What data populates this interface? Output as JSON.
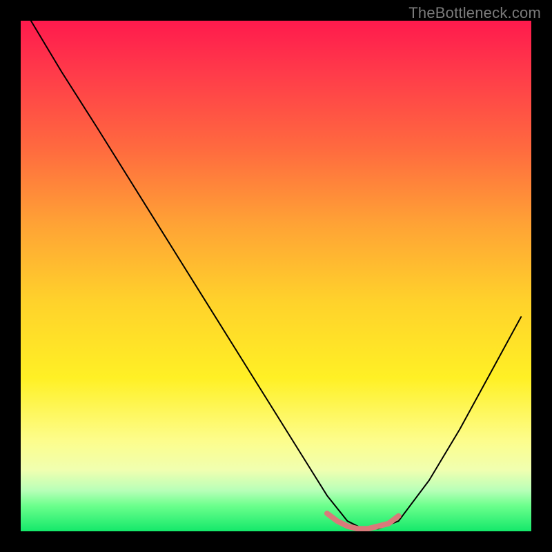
{
  "watermark": "TheBottleneck.com",
  "chart_data": {
    "type": "line",
    "title": "",
    "xlabel": "",
    "ylabel": "",
    "xlim": [
      0,
      100
    ],
    "ylim": [
      0,
      100
    ],
    "background": "rainbow-gradient (red top → green bottom)",
    "series": [
      {
        "name": "curve",
        "color": "#000000",
        "stroke_width": 2,
        "x": [
          2,
          8,
          15,
          25,
          35,
          45,
          55,
          60,
          64,
          67,
          70,
          74,
          80,
          86,
          92,
          98
        ],
        "y": [
          100,
          90,
          79,
          63,
          47,
          31,
          15,
          7,
          2,
          0.5,
          0.5,
          2,
          10,
          20,
          31,
          42
        ]
      },
      {
        "name": "valley-highlight",
        "color": "#d97a7a",
        "stroke_width": 8,
        "x": [
          60,
          62,
          64,
          66,
          68,
          70,
          72,
          74
        ],
        "y": [
          3.5,
          2,
          1,
          0.5,
          0.5,
          1,
          1.5,
          3
        ]
      }
    ]
  }
}
